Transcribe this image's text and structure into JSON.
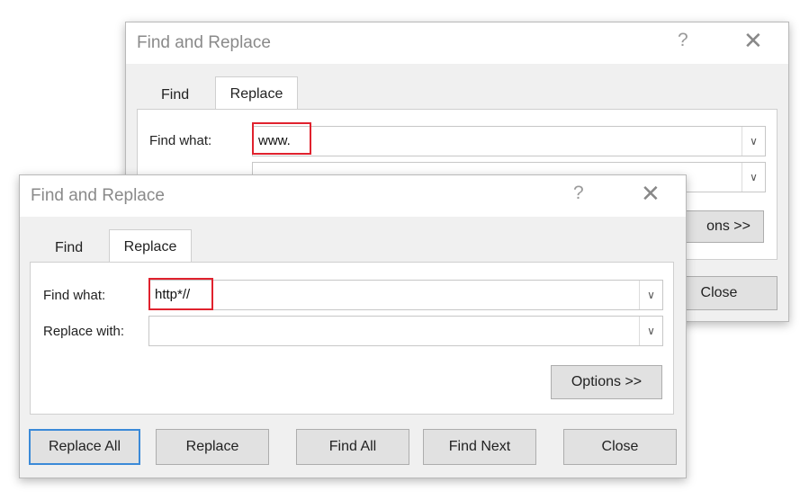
{
  "back_dialog": {
    "title": "Find and Replace",
    "help": "?",
    "close": "✕",
    "tabs": {
      "find": "Find",
      "replace": "Replace"
    },
    "find_label": "Find what:",
    "find_value": "www.",
    "options_visible": "ons >>",
    "close_label": "Close"
  },
  "front_dialog": {
    "title": "Find and Replace",
    "help": "?",
    "close": "✕",
    "tabs": {
      "find": "Find",
      "replace": "Replace"
    },
    "find_label": "Find what:",
    "find_value": "http*//",
    "replace_label": "Replace with:",
    "replace_value": "",
    "options_label": "Options >>",
    "buttons": {
      "replace_all": "Replace All",
      "replace": "Replace",
      "find_all": "Find All",
      "find_next": "Find Next",
      "close": "Close"
    }
  },
  "colors": {
    "highlight": "#e0222e",
    "default_button_border": "#3b8ad8"
  }
}
